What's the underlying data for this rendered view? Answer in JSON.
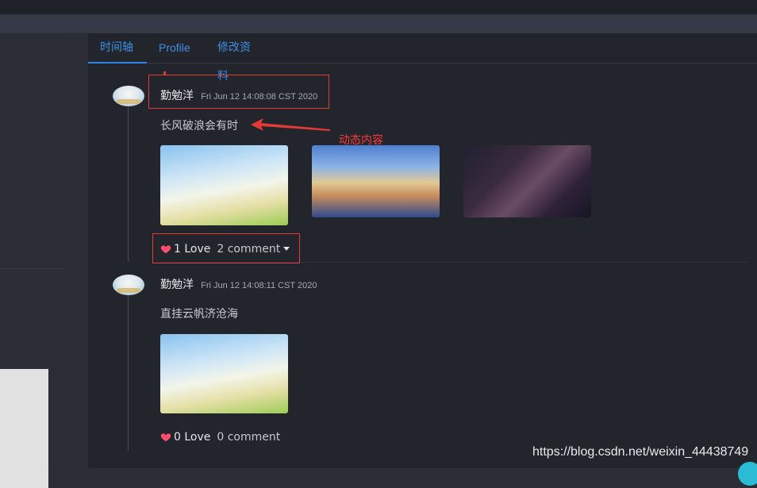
{
  "tabs": [
    {
      "label": "时间轴",
      "active": true
    },
    {
      "label": "Profile",
      "active": false
    },
    {
      "label": "修改资料",
      "active": false
    }
  ],
  "posts": [
    {
      "author": "勤勉洋",
      "time": "Fri Jun 12 14:08:08 CST 2020",
      "content": "长风破浪会有时",
      "images": [
        "illustrated-garden-scene",
        "sky-clouds-scene",
        "rainy-umbrella-scene"
      ],
      "love_label": "1 Love",
      "comment_label": "2 comment",
      "comment_has_dropdown": true
    },
    {
      "author": "勤勉洋",
      "time": "Fri Jun 12 14:08:11 CST 2020",
      "content": "直挂云帆济沧海",
      "images": [
        "illustrated-garden-scene"
      ],
      "love_label": "0 Love",
      "comment_label": "0 comment",
      "comment_has_dropdown": false
    }
  ],
  "annotation": {
    "label": "动态内容",
    "color": "#e53935"
  },
  "colors": {
    "tab_accent": "#2f86ea",
    "heart": "#ff4d6d",
    "background": "#23252c"
  },
  "watermark": "https://blog.csdn.net/weixin_44438749"
}
